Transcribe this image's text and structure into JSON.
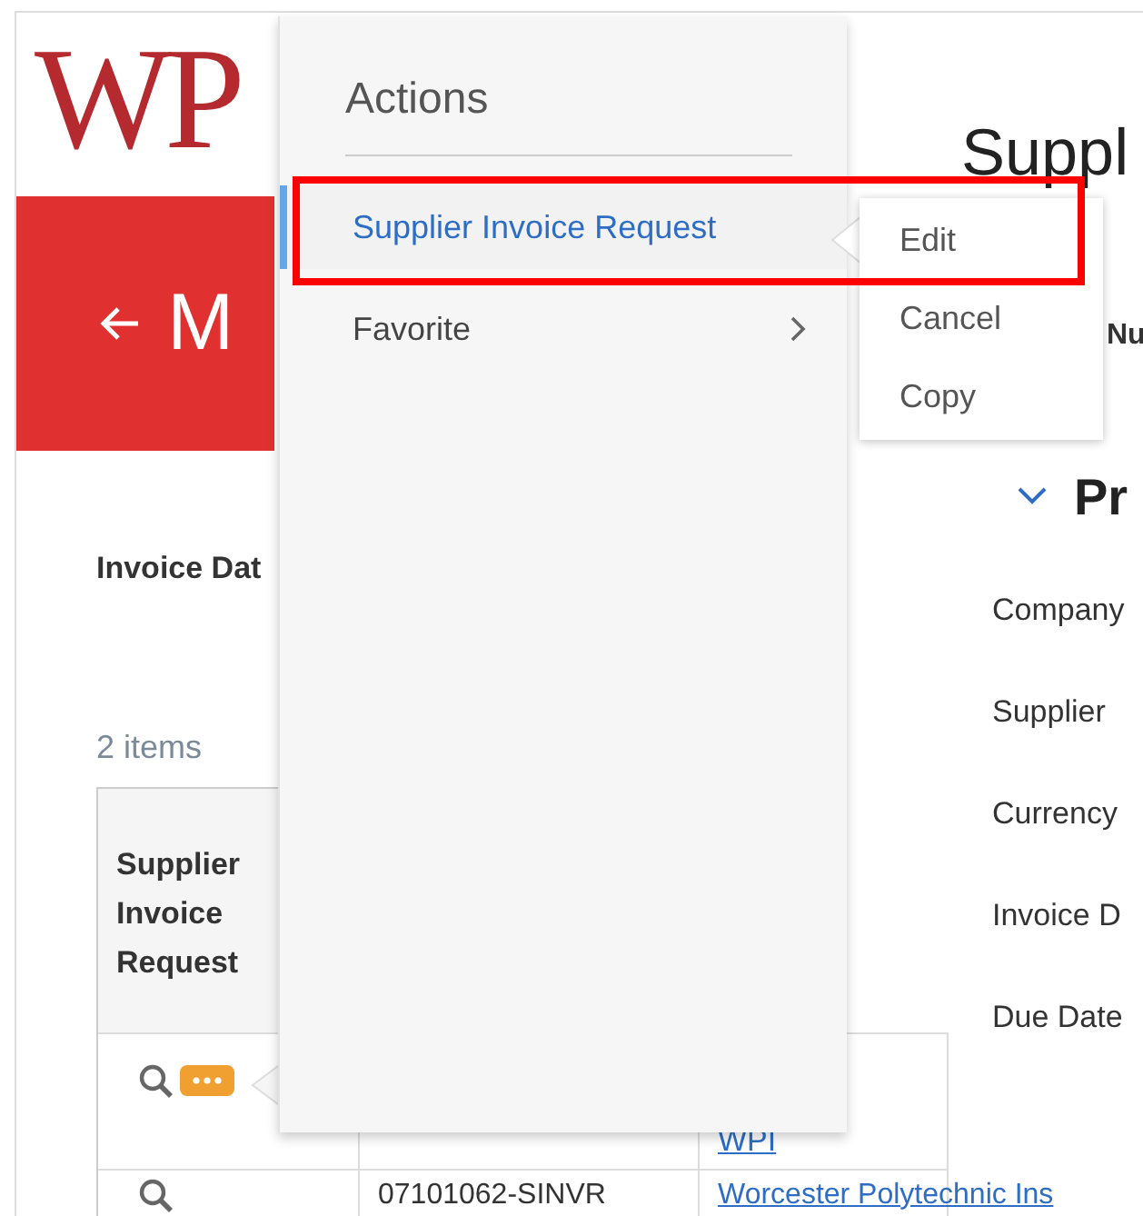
{
  "logo": {
    "text": "WP"
  },
  "banner": {
    "title": "M"
  },
  "left_panel": {
    "invoice_date_label": "Invoice Dat",
    "item_count": "2 items",
    "table": {
      "columns": [
        "Supplier Invoice Request"
      ],
      "rows": [
        {
          "related_actions_shown": true,
          "column_3": "WPI"
        },
        {
          "related_actions_shown": false,
          "column_2": "07101062-SINVR",
          "column_3": "Worcester Polytechnic Ins"
        }
      ]
    }
  },
  "main": {
    "title": "Suppl",
    "number_label": "Nu",
    "section": {
      "expanded": true,
      "title": "Pr",
      "fields": [
        "Company",
        "Supplier",
        "Currency",
        "Invoice D",
        "Due Date"
      ]
    }
  },
  "actions_menu": {
    "title": "Actions",
    "items": [
      {
        "label": "Supplier Invoice Request",
        "selected": true,
        "has_submenu": false
      },
      {
        "label": "Favorite",
        "selected": false,
        "has_submenu": true
      }
    ],
    "submenu": {
      "items": [
        "Edit",
        "Cancel",
        "Copy"
      ]
    },
    "annotation": {
      "highlight": true
    }
  }
}
